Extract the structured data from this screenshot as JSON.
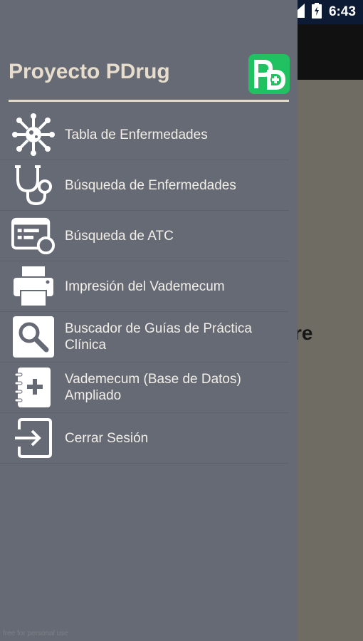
{
  "status_bar": {
    "time": "6:43",
    "icons": [
      "wifi-icon",
      "signal-icon",
      "battery-icon"
    ]
  },
  "background": {
    "partial_text": "re"
  },
  "drawer": {
    "title": "Proyecto PDrug",
    "logo": {
      "text": "PD",
      "icon": "pdrug-logo-icon",
      "color": "#21c161"
    },
    "items": [
      {
        "label": "Tabla de Enfermedades",
        "icon": "virus-icon"
      },
      {
        "label": "Búsqueda de Enfermedades",
        "icon": "stethoscope-icon"
      },
      {
        "label": "Búsqueda de ATC",
        "icon": "form-search-icon"
      },
      {
        "label": "Impresión del Vademecum",
        "icon": "printer-icon"
      },
      {
        "label": "Buscador de Guías de Práctica Clínica",
        "icon": "magnifier-icon"
      },
      {
        "label": "Vademecum (Base de Datos) Ampliado",
        "icon": "notebook-plus-icon"
      },
      {
        "label": "Cerrar Sesión",
        "icon": "logout-icon"
      }
    ],
    "footer_note": "free for personal use"
  },
  "colors": {
    "drawer_bg": "#666a75",
    "title": "#e7ddcc",
    "accent_green": "#21c161",
    "status_bar": "#0c1a33"
  }
}
